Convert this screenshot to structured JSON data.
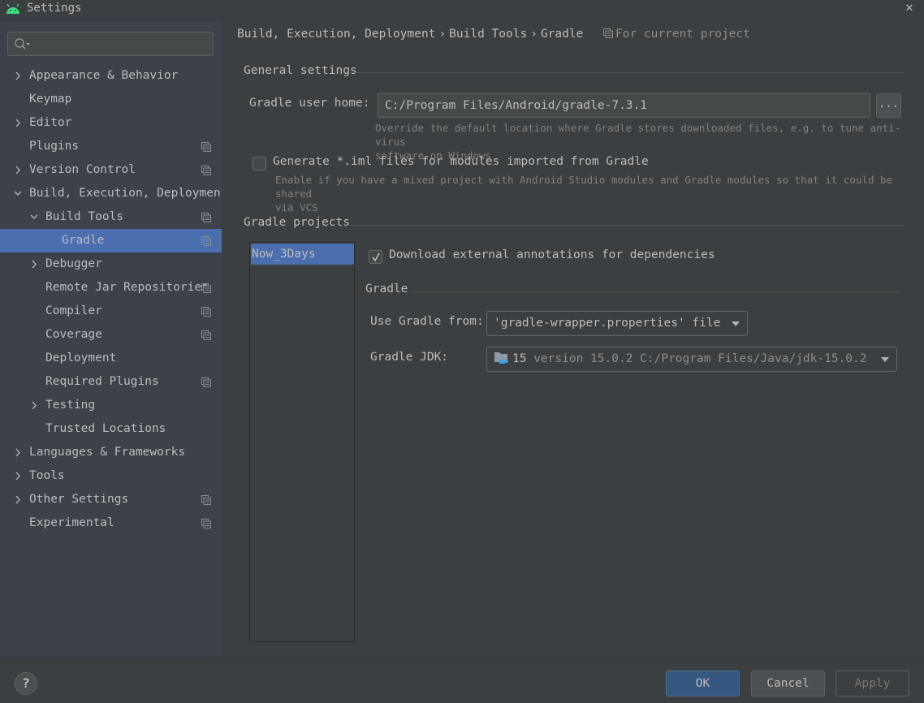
{
  "window": {
    "title": "Settings",
    "app_icon": "android-icon",
    "close_icon": "close-icon"
  },
  "sidebar": {
    "search": {
      "value": "",
      "placeholder": ""
    },
    "items": [
      {
        "label": "Appearance & Behavior",
        "level": 0,
        "expander": "collapsed",
        "project_scope": false
      },
      {
        "label": "Keymap",
        "level": 0,
        "expander": "none",
        "project_scope": false
      },
      {
        "label": "Editor",
        "level": 0,
        "expander": "collapsed",
        "project_scope": false
      },
      {
        "label": "Plugins",
        "level": 0,
        "expander": "none",
        "project_scope": true
      },
      {
        "label": "Version Control",
        "level": 0,
        "expander": "collapsed",
        "project_scope": true
      },
      {
        "label": "Build, Execution, Deployment",
        "level": 0,
        "expander": "expanded",
        "project_scope": false
      },
      {
        "label": "Build Tools",
        "level": 1,
        "expander": "expanded",
        "project_scope": true
      },
      {
        "label": "Gradle",
        "level": 2,
        "expander": "none",
        "project_scope": true,
        "selected": true
      },
      {
        "label": "Debugger",
        "level": 1,
        "expander": "collapsed",
        "project_scope": false
      },
      {
        "label": "Remote Jar Repositories",
        "level": 1,
        "expander": "none",
        "project_scope": true
      },
      {
        "label": "Compiler",
        "level": 1,
        "expander": "none",
        "project_scope": true
      },
      {
        "label": "Coverage",
        "level": 1,
        "expander": "none",
        "project_scope": true
      },
      {
        "label": "Deployment",
        "level": 1,
        "expander": "none",
        "project_scope": false
      },
      {
        "label": "Required Plugins",
        "level": 1,
        "expander": "none",
        "project_scope": true
      },
      {
        "label": "Testing",
        "level": 1,
        "expander": "collapsed",
        "project_scope": false
      },
      {
        "label": "Trusted Locations",
        "level": 1,
        "expander": "none",
        "project_scope": false
      },
      {
        "label": "Languages & Frameworks",
        "level": 0,
        "expander": "collapsed",
        "project_scope": false
      },
      {
        "label": "Tools",
        "level": 0,
        "expander": "collapsed",
        "project_scope": false
      },
      {
        "label": "Other Settings",
        "level": 0,
        "expander": "collapsed",
        "project_scope": true
      },
      {
        "label": "Experimental",
        "level": 0,
        "expander": "none",
        "project_scope": true
      }
    ]
  },
  "header": {
    "breadcrumb": [
      "Build, Execution, Deployment",
      "Build Tools",
      "Gradle"
    ],
    "separator": "›",
    "scope_label": "For current project"
  },
  "general": {
    "section_title": "General settings",
    "gradle_home_label": "Gradle user home:",
    "gradle_home_value": "C:/Program Files/Android/gradle-7.3.1",
    "browse_label": "...",
    "gradle_home_hint_line1": "Override the default location where Gradle stores downloaded files, e.g. to tune anti-virus",
    "gradle_home_hint_line2": "software on Windows",
    "generate_iml_label": "Generate *.iml files for modules imported from Gradle",
    "generate_iml_checked": false,
    "generate_iml_hint_line1": "Enable if you have a mixed project with Android Studio modules and Gradle modules so that it could be shared",
    "generate_iml_hint_line2": "via VCS"
  },
  "projects": {
    "section_title": "Gradle projects",
    "list": [
      "Now_3Days"
    ],
    "selected": "Now_3Days",
    "download_annotations_label": "Download external annotations for dependencies",
    "download_annotations_checked": true,
    "gradle_section_title": "Gradle",
    "use_gradle_from_label": "Use Gradle from:",
    "use_gradle_from_value": "'gradle-wrapper.properties' file",
    "gradle_jdk_label": "Gradle JDK:",
    "gradle_jdk_version": "15",
    "gradle_jdk_detail": "version 15.0.2 C:/Program Files/Java/jdk-15.0.2"
  },
  "footer": {
    "help_label": "?",
    "ok_label": "OK",
    "cancel_label": "Cancel",
    "apply_label": "Apply",
    "apply_enabled": false
  },
  "colors": {
    "selection": "#4b6eaf",
    "primary_button": "#365880",
    "android_green": "#3ddc84",
    "jdk_cup": "#3d9ee0"
  }
}
